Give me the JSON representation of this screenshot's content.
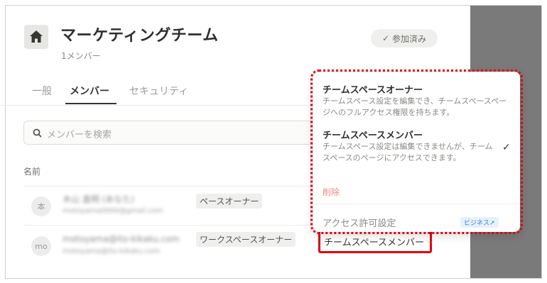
{
  "team": {
    "name": "マーケティングチーム",
    "member_count": "1メンバー",
    "joined_label": "参加済み"
  },
  "tabs": [
    {
      "label": "一般"
    },
    {
      "label": "メンバー",
      "active": true
    },
    {
      "label": "セキュリティ"
    }
  ],
  "search": {
    "placeholder": "メンバーを検索"
  },
  "table": {
    "name_header": "名前"
  },
  "members": [
    {
      "avatar": "本",
      "name": "木山 直明 (あなた)",
      "email": "motoyama0000@gmail.com",
      "role_tag": "ペースオーナー"
    },
    {
      "avatar": "mo",
      "name": "motoyama@ito-kikaku.com",
      "email": "motoyama@ito-kikaku.com",
      "role_tag": "ワークスペースオーナー"
    }
  ],
  "role_select": {
    "value": "チームスペースメンバー"
  },
  "role_menu": {
    "options": [
      {
        "title": "チームスペースオーナー",
        "description": "チームスペース設定を編集でき、チームスペースページへのフルアクセス権限を持ちます。"
      },
      {
        "title": "チームスペースメンバー",
        "description": "チームスペース設定は編集できませんが、チームスペースのページにアクセスできます。",
        "selected": true
      }
    ],
    "delete_label": "削除",
    "access_label": "アクセス許可設定",
    "business_badge": "ビジネス↗"
  },
  "colors": {
    "highlight": "#e0000f",
    "overlay": "#7a7a7a"
  }
}
